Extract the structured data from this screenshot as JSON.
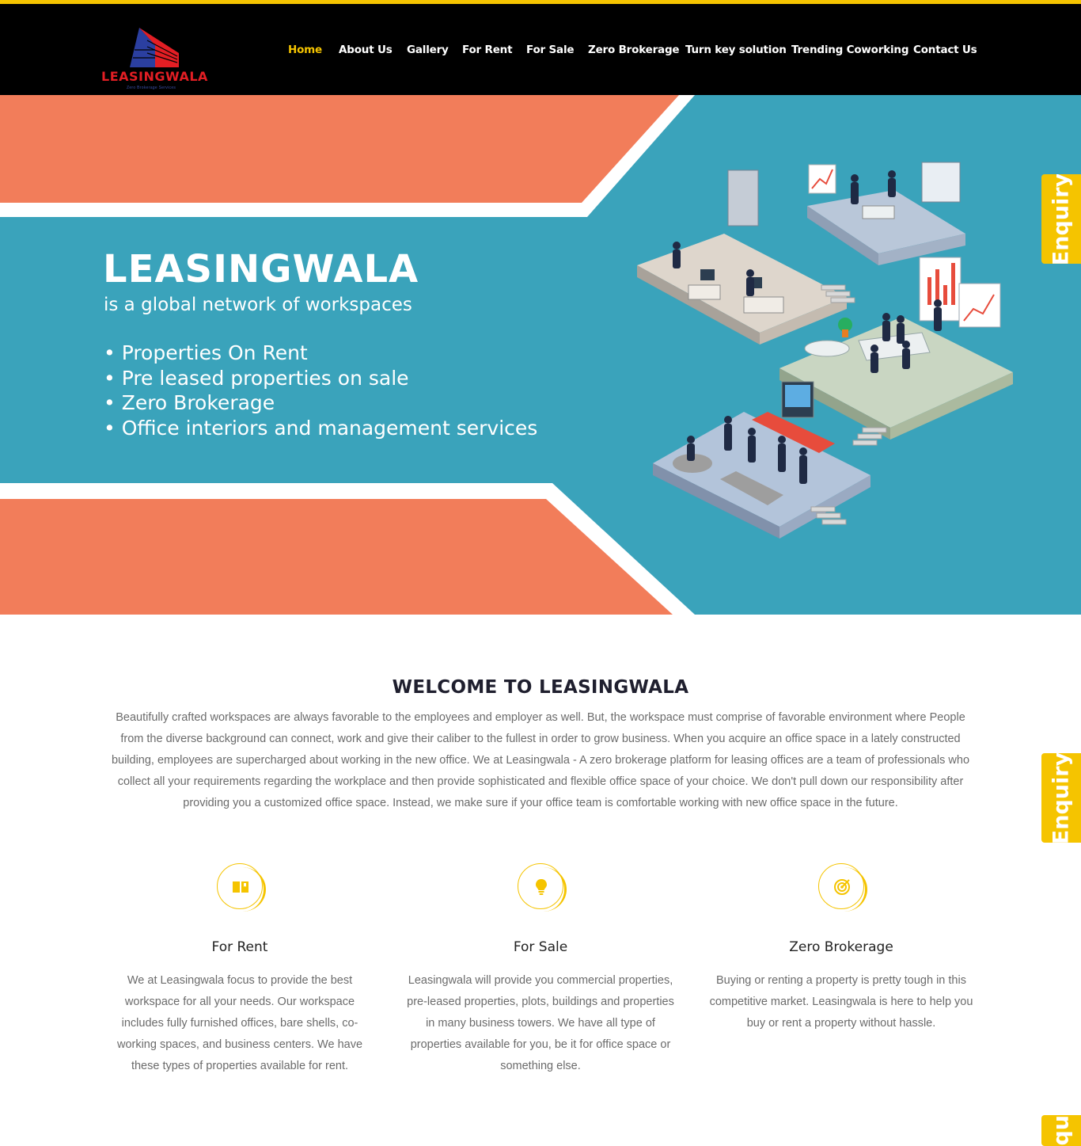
{
  "colors": {
    "accent": "#f5c400",
    "hero_teal": "#3aa3bb",
    "hero_coral": "#f27d5a",
    "logo_red": "#e31e24",
    "logo_blue": "#2b3fa0"
  },
  "logo": {
    "name": "LEASINGWALA",
    "tagline": "Zero Brokerage Services"
  },
  "nav": {
    "items": [
      "Home",
      "About Us",
      "Gallery",
      "For Rent",
      "For Sale",
      "Zero Brokerage",
      "Turn key solution",
      "Trending Coworking",
      "Contact Us"
    ],
    "active": "Home"
  },
  "hero": {
    "brand": "LEASINGWALA",
    "tagline": "is a global network of workspaces",
    "bullets": [
      "• Properties On Rent",
      "• Pre leased properties on sale",
      "• Zero Brokerage",
      "• Office interiors and management services"
    ]
  },
  "enquiry": {
    "label": "Enquiry"
  },
  "welcome": {
    "title": "WELCOME TO LEASINGWALA",
    "text": "Beautifully crafted workspaces are always favorable to the employees and employer as well. But, the workspace must comprise of favorable environment where People from the diverse background can connect, work and give their caliber to the fullest in order to grow business. When you acquire an office space in a lately constructed building, employees are supercharged about working in the new office. We at Leasingwala - A zero brokerage platform for leasing offices are a team of professionals who collect all your requirements regarding the workplace and then provide sophisticated and flexible office space of your choice. We don't pull down our responsibility after providing you a customized office space. Instead, we make sure if your office team is comfortable working with new office space in the future."
  },
  "features": [
    {
      "icon": "book-icon",
      "title": "For Rent",
      "text": "We at Leasingwala focus to provide the best workspace for all your needs. Our workspace includes fully furnished offices, bare shells, co-working spaces, and business centers. We have these types of properties available for rent."
    },
    {
      "icon": "lightbulb-icon",
      "title": "For Sale",
      "text": "Leasingwala will provide you commercial properties, pre-leased properties, plots, buildings and properties in many business towers. We have all type of properties available for you, be it for office space or something else."
    },
    {
      "icon": "target-icon",
      "title": "Zero Brokerage",
      "text": "Buying or renting a property is pretty tough in this competitive market. Leasingwala is here to help you buy or rent a property without hassle."
    }
  ]
}
